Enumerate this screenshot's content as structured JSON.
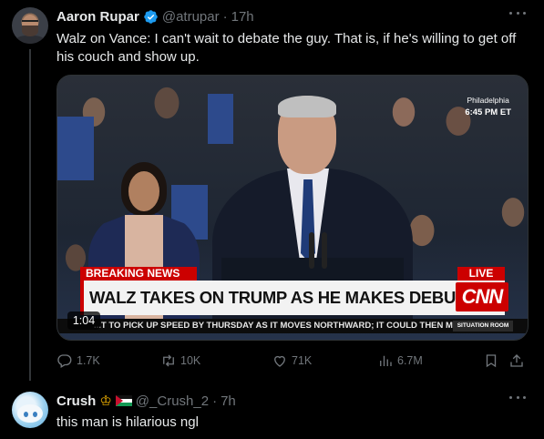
{
  "tweet": {
    "author_name": "Aaron Rupar",
    "handle": "@atrupar",
    "separator": "·",
    "time": "17h",
    "text": "Walz on Vance: I can't wait to debate the guy. That is, if he's willing to get off his couch and show up.",
    "verified_color": "#1d9bf0",
    "video": {
      "location": "Philadelphia",
      "clock": "6:45 PM ET",
      "breaking": "BREAKING NEWS",
      "live": "LIVE",
      "headline": "WALZ TAKES ON TRUMP AS HE MAKES DEBUT AS HARRIS' VP PICK",
      "network": "CNN",
      "crawl": "...T TO PICK UP SPEED BY THURSDAY AS IT MOVES NORTHWARD; IT COULD THEN MA",
      "program": "SITUATION ROOM",
      "duration": "1:04"
    },
    "actions": {
      "reply_count": "1.7K",
      "repost_count": "10K",
      "like_count": "71K",
      "view_count": "6.7M"
    }
  },
  "reply": {
    "author_name": "Crush",
    "handle": "@_Crush_2",
    "separator": "·",
    "time": "7h",
    "text": "this man is hilarious ngl"
  },
  "colors": {
    "background": "#000000",
    "text_primary": "#e7e9ea",
    "text_secondary": "#71767b",
    "accent": "#1d9bf0",
    "cnn_red": "#cc0000"
  }
}
